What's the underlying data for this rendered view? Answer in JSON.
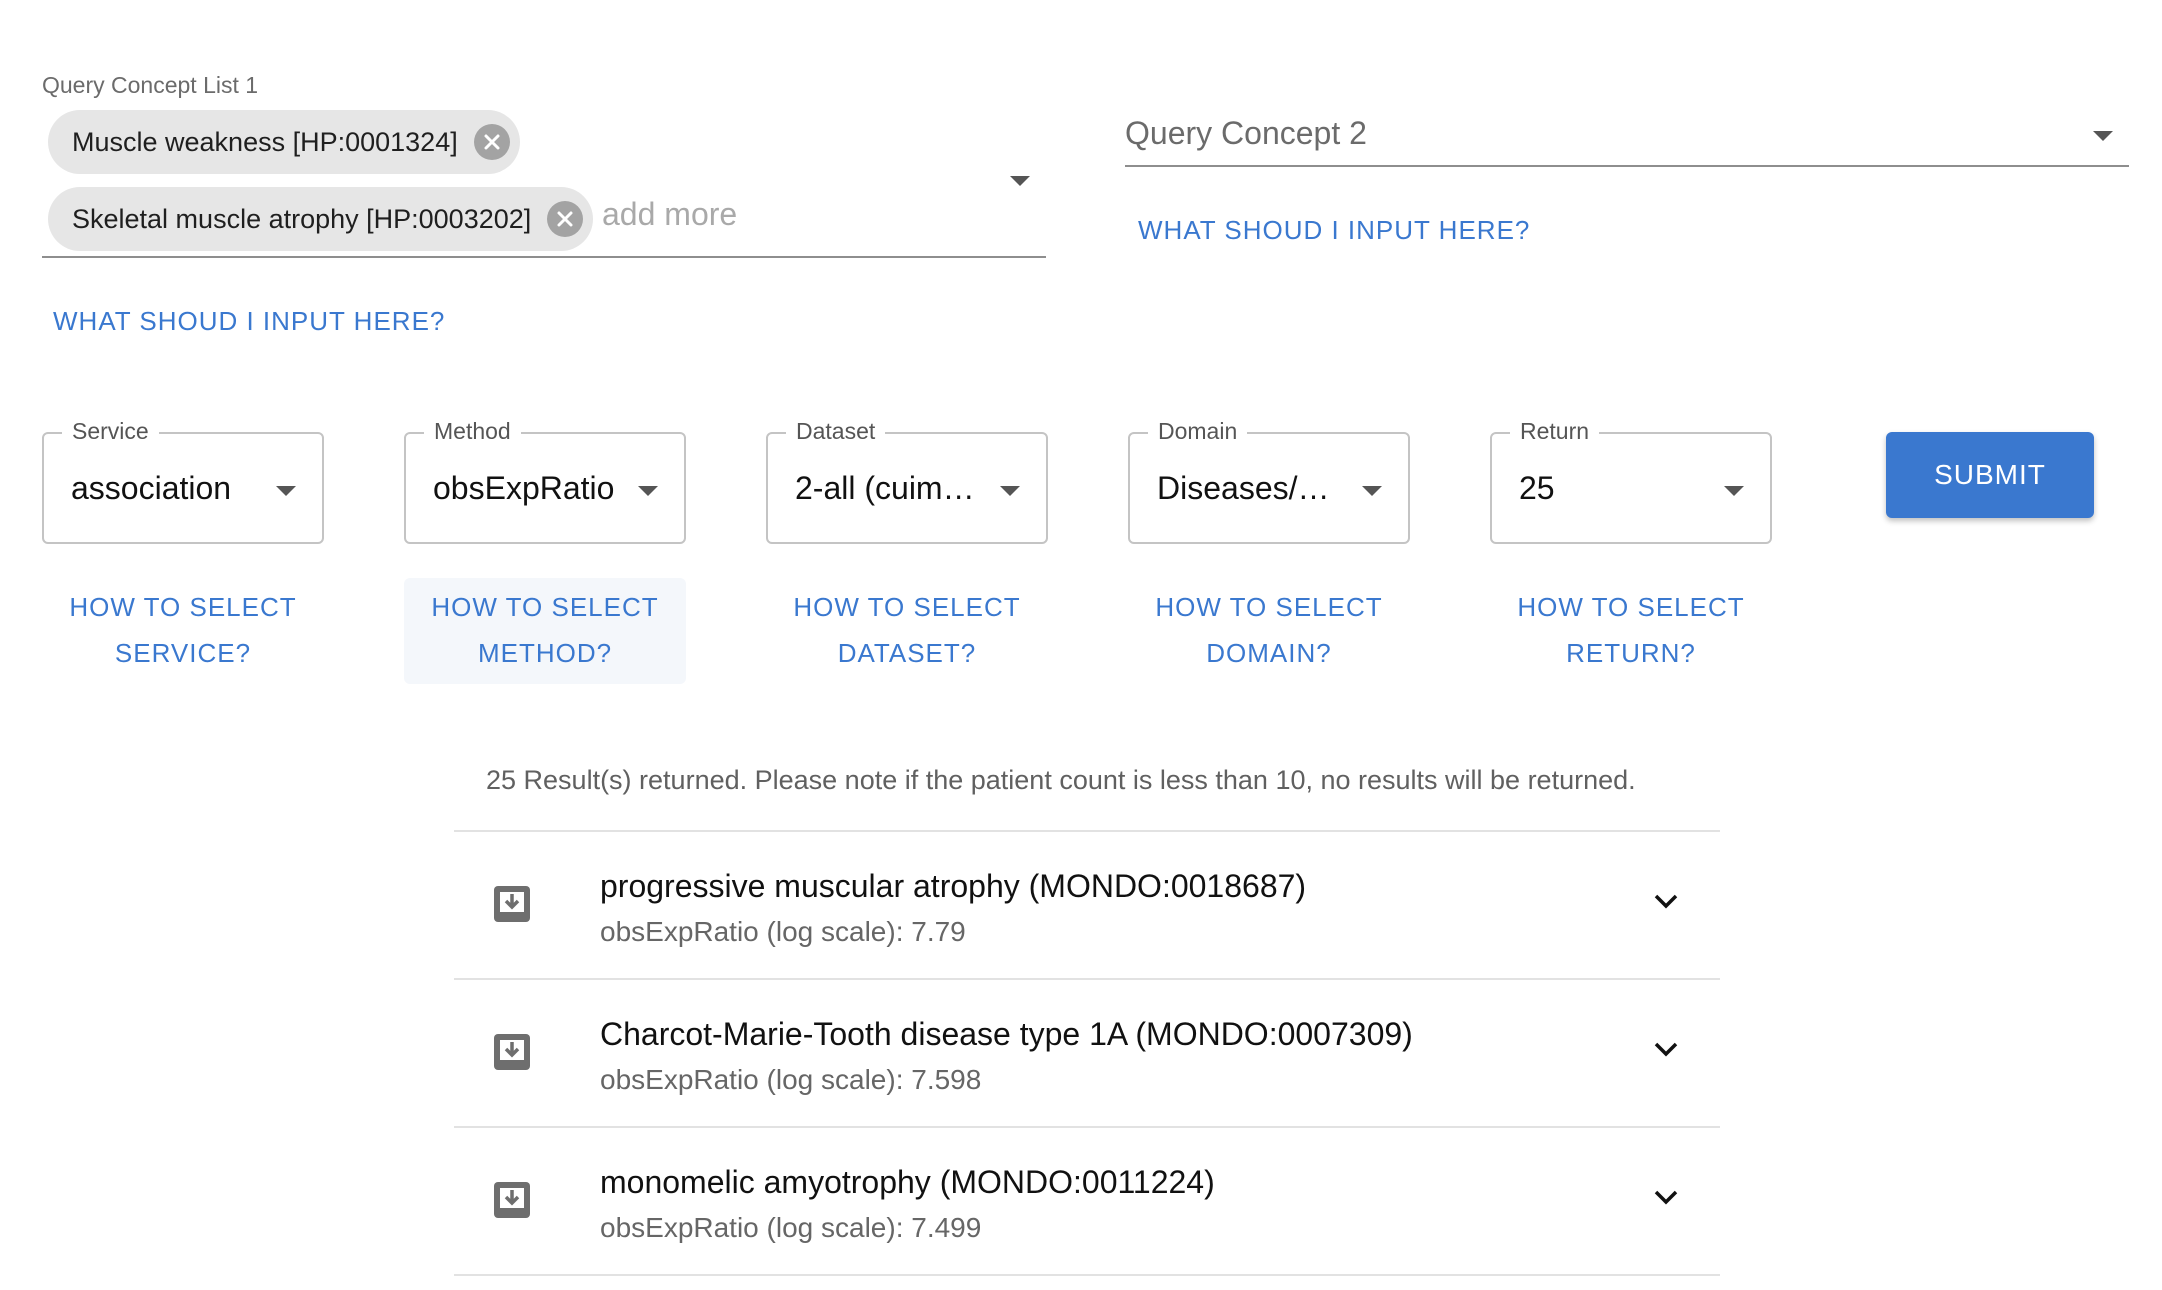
{
  "query1": {
    "label": "Query Concept List 1",
    "chips": [
      {
        "text": "Muscle weakness [HP:0001324]"
      },
      {
        "text": "Skeletal muscle atrophy [HP:0003202]"
      }
    ],
    "placeholder": "add more",
    "help": "WHAT SHOUD I INPUT HERE?"
  },
  "query2": {
    "placeholder": "Query Concept 2",
    "help": "WHAT SHOUD I INPUT HERE?"
  },
  "selects": [
    {
      "label": "Service",
      "value": "association",
      "help_line1": "HOW TO SELECT",
      "help_line2": "SERVICE?"
    },
    {
      "label": "Method",
      "value": "obsExpRatio",
      "help_line1": "HOW TO SELECT",
      "help_line2": "METHOD?"
    },
    {
      "label": "Dataset",
      "value": "2-all (cuim…",
      "help_line1": "HOW TO SELECT",
      "help_line2": "DATASET?"
    },
    {
      "label": "Domain",
      "value": "Diseases/…",
      "help_line1": "HOW TO SELECT",
      "help_line2": "DOMAIN?"
    },
    {
      "label": "Return",
      "value": "25",
      "help_line1": "HOW TO SELECT",
      "help_line2": "RETURN?"
    }
  ],
  "submit_label": "SUBMIT",
  "results": {
    "note": "25 Result(s) returned. Please note if the patient count is less than 10, no results will be returned.",
    "items": [
      {
        "title": "progressive muscular atrophy (MONDO:0018687)",
        "score": "obsExpRatio (log scale): 7.79"
      },
      {
        "title": "Charcot-Marie-Tooth disease type 1A (MONDO:0007309)",
        "score": "obsExpRatio (log scale): 7.598"
      },
      {
        "title": "monomelic amyotrophy (MONDO:0011224)",
        "score": "obsExpRatio (log scale): 7.499"
      }
    ]
  },
  "colors": {
    "accent": "#3a78cf",
    "chip_bg": "#e6e6e6",
    "divider": "#e2e2e2"
  }
}
